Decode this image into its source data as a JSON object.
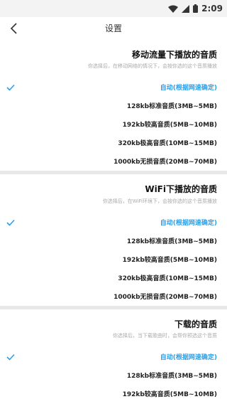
{
  "status": {
    "time": "2:09"
  },
  "nav": {
    "title": "设置"
  },
  "sections": [
    {
      "title": "移动流量下播放的音质",
      "desc": "你选择后，在移动网络的情况下，会按你选的这个音质播放",
      "options": [
        "自动(根据网速确定)",
        "128kb标准音质(3MB~5MB)",
        "192kb较高音质(5MB~10MB)",
        "320kb极高音质(10MB~15MB)",
        "1000kb无损音质(20MB~70MB)"
      ],
      "selected": 0
    },
    {
      "title": "WiFi下播放的音质",
      "desc": "你选择后，在WiFi环境下，会按你选的这个音质播放",
      "options": [
        "自动(根据网速确定)",
        "128kb标准音质(3MB~5MB)",
        "192kb较高音质(5MB~10MB)",
        "320kb极高音质(10MB~15MB)",
        "1000kb无损音质(20MB~70MB)"
      ],
      "selected": 0
    },
    {
      "title": "下载的音质",
      "desc": "你选择后，当下载歌曲时，会帮你预选这个音质",
      "options": [
        "自动(根据网速确定)",
        "128kb标准音质(3MB~5MB)",
        "192kb较高音质(5MB~10MB)"
      ],
      "selected": 0
    }
  ],
  "accent_color": "#2e9fe6",
  "icons": {
    "back": "chevron-left-icon",
    "check": "check-icon",
    "wifi": "wifi-icon",
    "signal": "signal-icon",
    "battery": "battery-icon"
  }
}
